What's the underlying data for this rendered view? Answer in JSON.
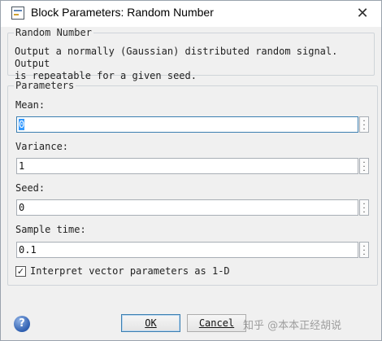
{
  "window": {
    "title": "Block Parameters: Random Number",
    "close_icon": "close-icon"
  },
  "block": {
    "group_label": "Random Number",
    "description": "Output a normally (Gaussian) distributed random signal.  Output\nis repeatable for a given seed."
  },
  "parameters": {
    "group_label": "Parameters",
    "fields": [
      {
        "label": "Mean:",
        "value": "0"
      },
      {
        "label": "Variance:",
        "value": "1"
      },
      {
        "label": "Seed:",
        "value": "0"
      },
      {
        "label": "Sample time:",
        "value": "0.1"
      }
    ],
    "checkbox": {
      "label": "Interpret vector parameters as 1-D",
      "checked": true,
      "mark": "✓"
    }
  },
  "footer": {
    "help_glyph": "?",
    "ok_label": "OK",
    "cancel_label": "Cancel",
    "watermark": "知乎 @本本正经胡说"
  }
}
